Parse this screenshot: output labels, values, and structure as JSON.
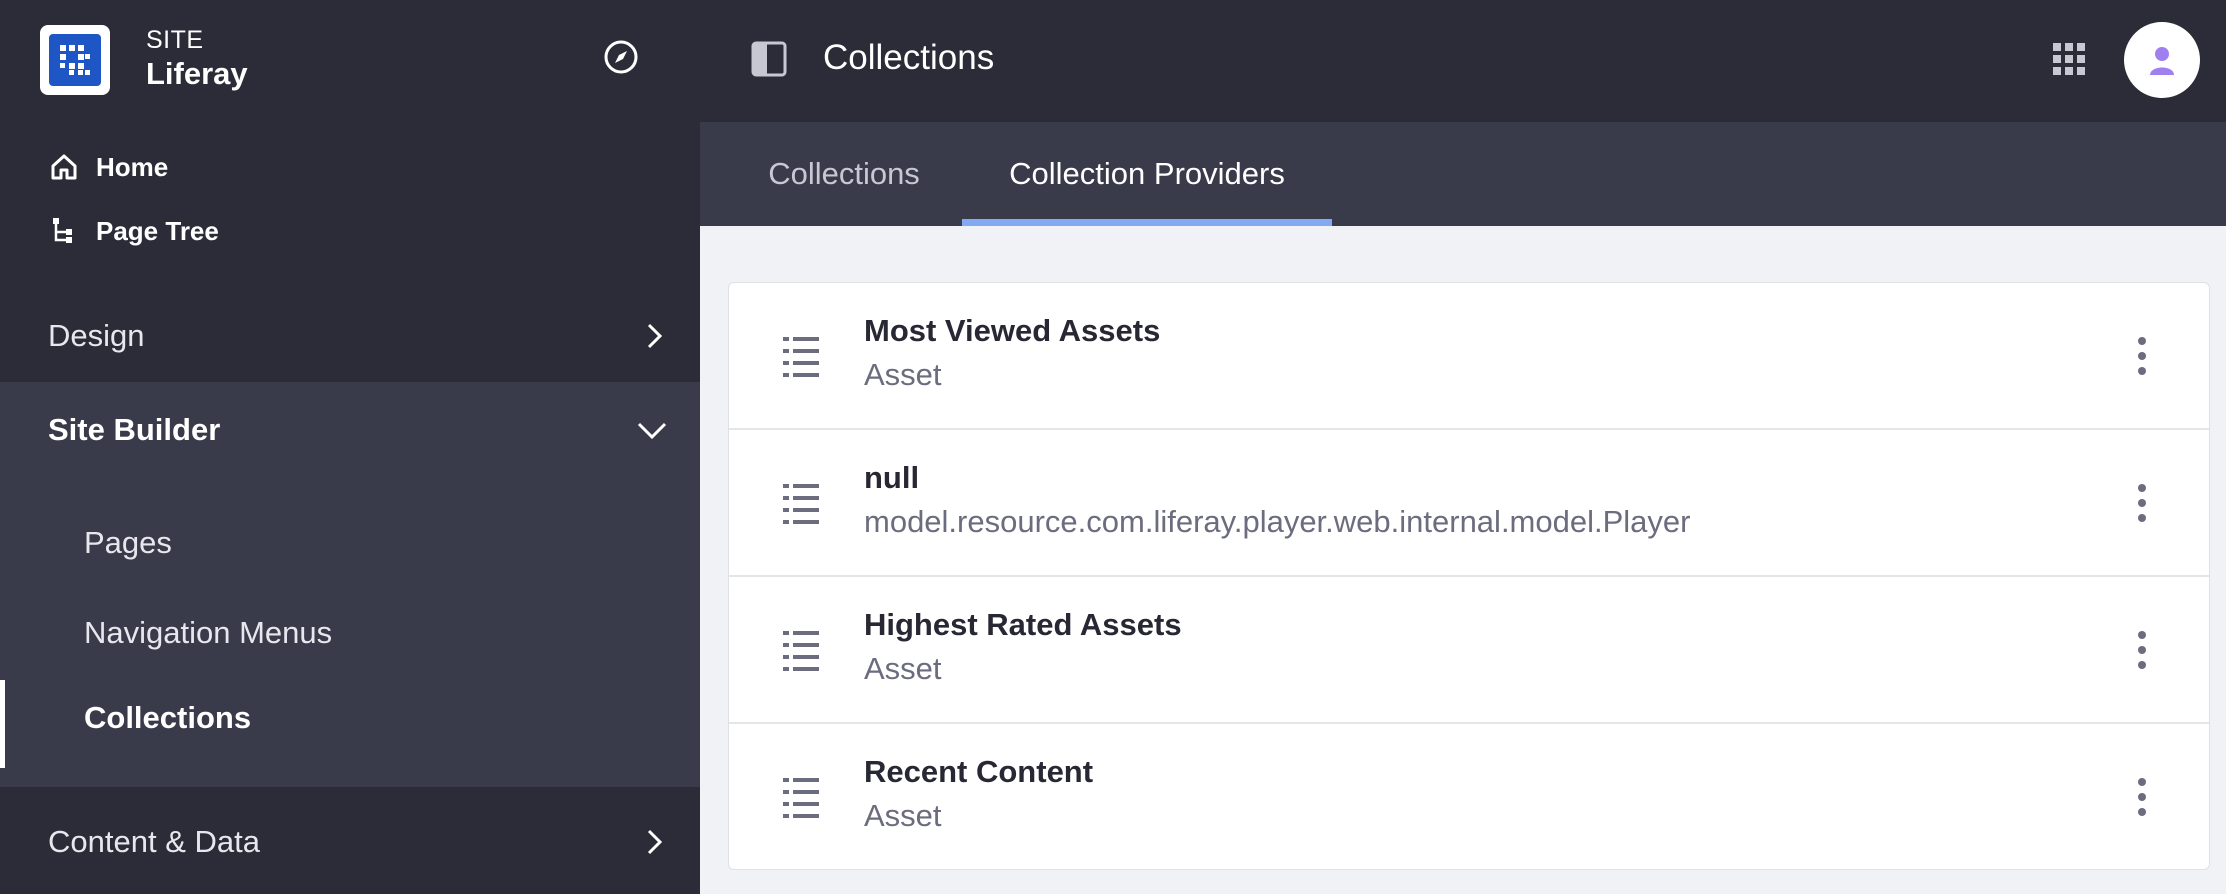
{
  "colors": {
    "sidebar_bg": "#2b2c37",
    "sidebar_section_bg": "#393a4a",
    "tab_indicator": "#82a9f2",
    "logo_blue": "#1e56c5",
    "avatar_purple": "#a07ff1"
  },
  "sidebar": {
    "site_kicker": "SITE",
    "site_name": "Liferay",
    "logo_icon": "liferay-logo-icon",
    "compass_icon": "compass-icon",
    "quick_links": [
      {
        "label": "Home",
        "icon": "home-icon"
      },
      {
        "label": "Page Tree",
        "icon": "page-tree-icon"
      }
    ],
    "sections": {
      "design": {
        "label": "Design",
        "icon": "chevron-right-icon"
      },
      "site_builder": {
        "label": "Site Builder",
        "icon": "chevron-down-icon",
        "items": [
          {
            "label": "Pages"
          },
          {
            "label": "Navigation Menus"
          },
          {
            "label": "Collections",
            "active": true
          }
        ]
      },
      "content_data": {
        "label": "Content & Data",
        "icon": "chevron-right-icon"
      }
    }
  },
  "topbar": {
    "title": "Collections",
    "panel_icon": "panel-toggle-icon",
    "apps_icon": "apps-grid-icon",
    "avatar_icon": "user-avatar-icon"
  },
  "tabs": [
    {
      "label": "Collections",
      "active": false
    },
    {
      "label": "Collection Providers",
      "active": true
    }
  ],
  "providers": [
    {
      "title": "Most Viewed Assets",
      "subtitle": "Asset",
      "icon": "list-icon",
      "menu_icon": "kebab-menu-icon"
    },
    {
      "title": "null",
      "subtitle": "model.resource.com.liferay.player.web.internal.model.Player",
      "icon": "list-icon",
      "menu_icon": "kebab-menu-icon"
    },
    {
      "title": "Highest Rated Assets",
      "subtitle": "Asset",
      "icon": "list-icon",
      "menu_icon": "kebab-menu-icon"
    },
    {
      "title": "Recent Content",
      "subtitle": "Asset",
      "icon": "list-icon",
      "menu_icon": "kebab-menu-icon"
    }
  ]
}
